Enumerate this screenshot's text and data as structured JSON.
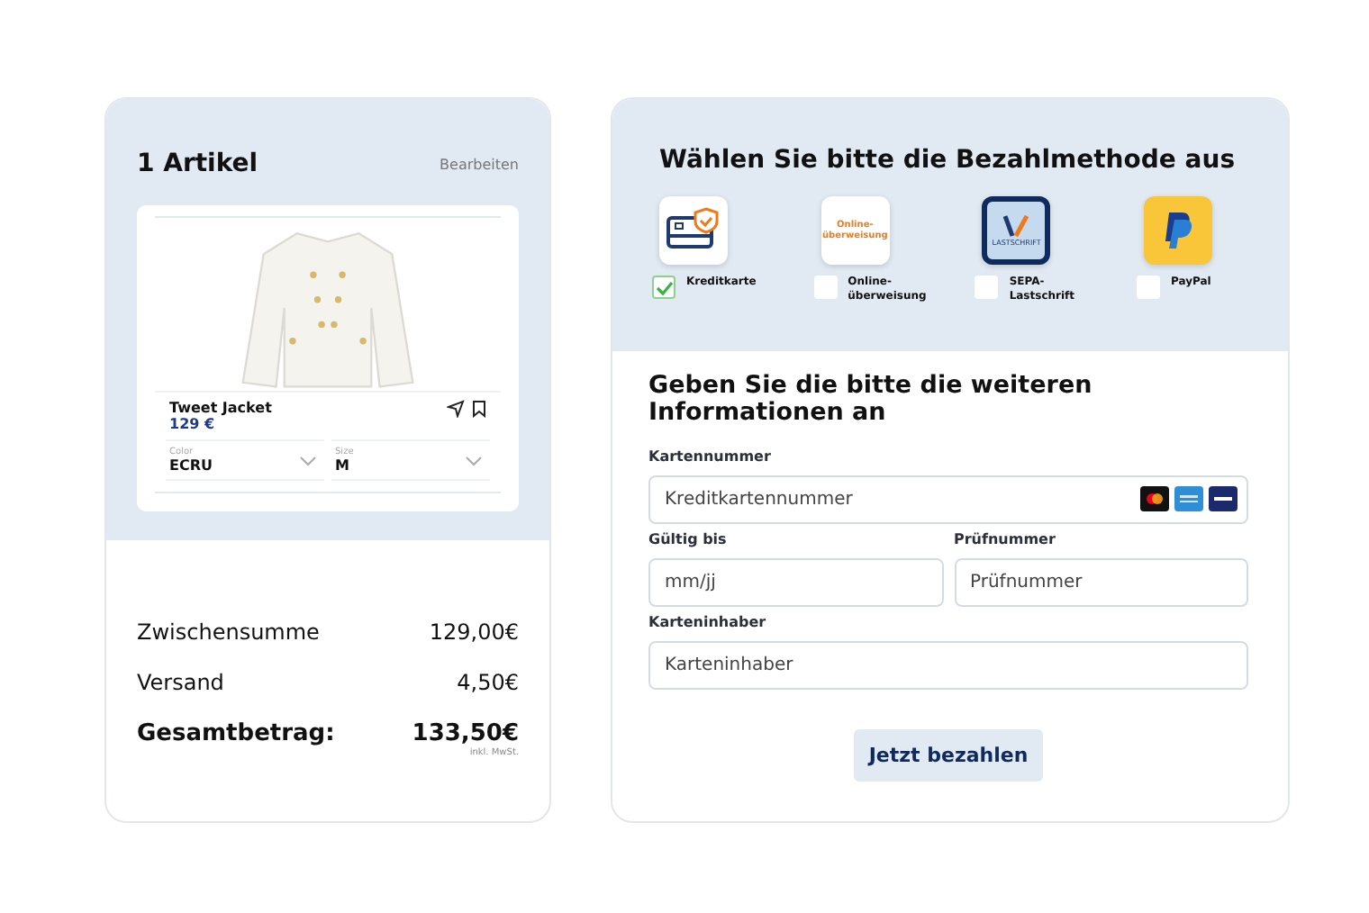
{
  "cart": {
    "title": "1 Artikel",
    "edit_link": "Bearbeiten",
    "item": {
      "name": "Tweet Jacket",
      "price": "129 €",
      "options": [
        {
          "label": "Color",
          "value": "ECRU"
        },
        {
          "label": "Size",
          "value": "M"
        }
      ]
    },
    "summary": [
      {
        "label": "Zwischensumme",
        "value": "129,00€",
        "kind": "line"
      },
      {
        "label": "Versand",
        "value": "4,50€",
        "kind": "line"
      },
      {
        "label": "Gesamtbetrag:",
        "value": "133,50€",
        "note": "inkl. MwSt.",
        "kind": "total"
      }
    ]
  },
  "payment": {
    "title": "Wählen Sie bitte die Bezahlmethode aus",
    "methods": [
      {
        "label": "Kreditkarte",
        "kind": "card",
        "selected": true
      },
      {
        "label": "Online-überweisung",
        "kind": "transfer",
        "logo_text": "Online-überweisung",
        "selected": false
      },
      {
        "label": "SEPA-Lastschrift",
        "kind": "sepa",
        "logo_text": "LASTSCHRIFT",
        "selected": false
      },
      {
        "label": "PayPal",
        "kind": "paypal",
        "selected": false
      }
    ]
  },
  "form": {
    "title": "Geben Sie die bitte die weiteren Informationen an",
    "rows": [
      [
        {
          "label": "Kartennummer",
          "placeholder": "Kreditkartennummer",
          "kind": "card-number"
        }
      ],
      [
        {
          "label": "Gültig bis",
          "placeholder": "mm/jj",
          "kind": "text"
        },
        {
          "label": "Prüfnummer",
          "placeholder": "Prüfnummer",
          "kind": "text"
        }
      ],
      [
        {
          "label": "Karteninhaber",
          "placeholder": "Karteninhaber",
          "kind": "text"
        }
      ]
    ],
    "submit": "Jetzt bezahlen"
  }
}
